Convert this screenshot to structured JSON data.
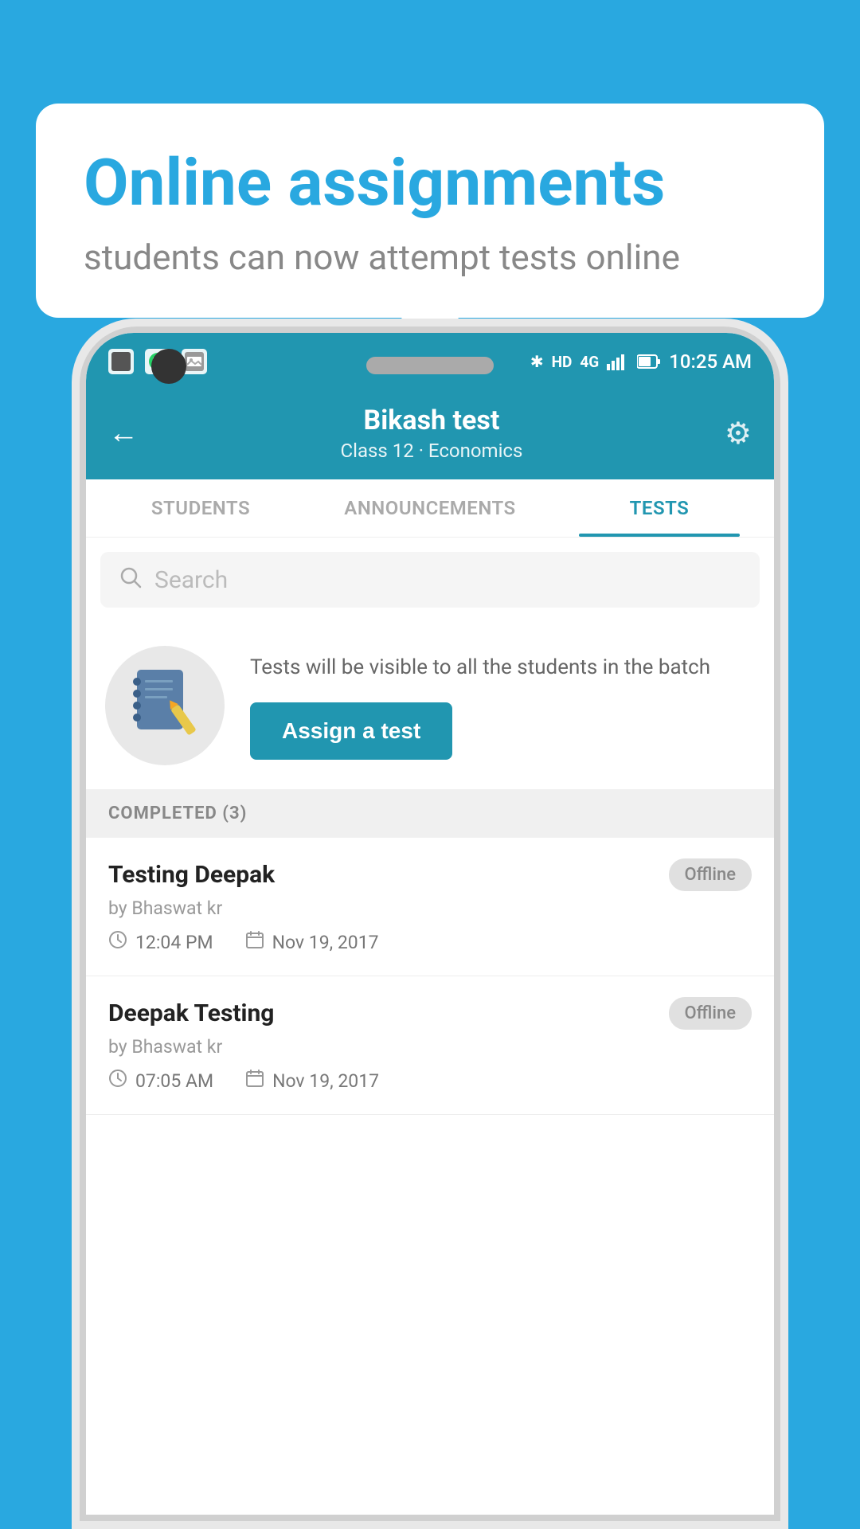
{
  "background_color": "#29a8e0",
  "speech_bubble": {
    "title": "Online assignments",
    "subtitle": "students can now attempt tests online"
  },
  "status_bar": {
    "time": "10:25 AM",
    "network": "HD 4G"
  },
  "header": {
    "title": "Bikash test",
    "subtitle": "Class 12 · Economics",
    "back_label": "←",
    "settings_label": "⚙"
  },
  "tabs": [
    {
      "label": "STUDENTS",
      "active": false
    },
    {
      "label": "ANNOUNCEMENTS",
      "active": false
    },
    {
      "label": "TESTS",
      "active": true
    }
  ],
  "search": {
    "placeholder": "Search"
  },
  "assign_section": {
    "description": "Tests will be visible to all the students in the batch",
    "button_label": "Assign a test"
  },
  "completed_section": {
    "header": "COMPLETED (3)",
    "items": [
      {
        "title": "Testing Deepak",
        "author": "by Bhaswat kr",
        "time": "12:04 PM",
        "date": "Nov 19, 2017",
        "badge": "Offline"
      },
      {
        "title": "Deepak Testing",
        "author": "by Bhaswat kr",
        "time": "07:05 AM",
        "date": "Nov 19, 2017",
        "badge": "Offline"
      }
    ]
  }
}
